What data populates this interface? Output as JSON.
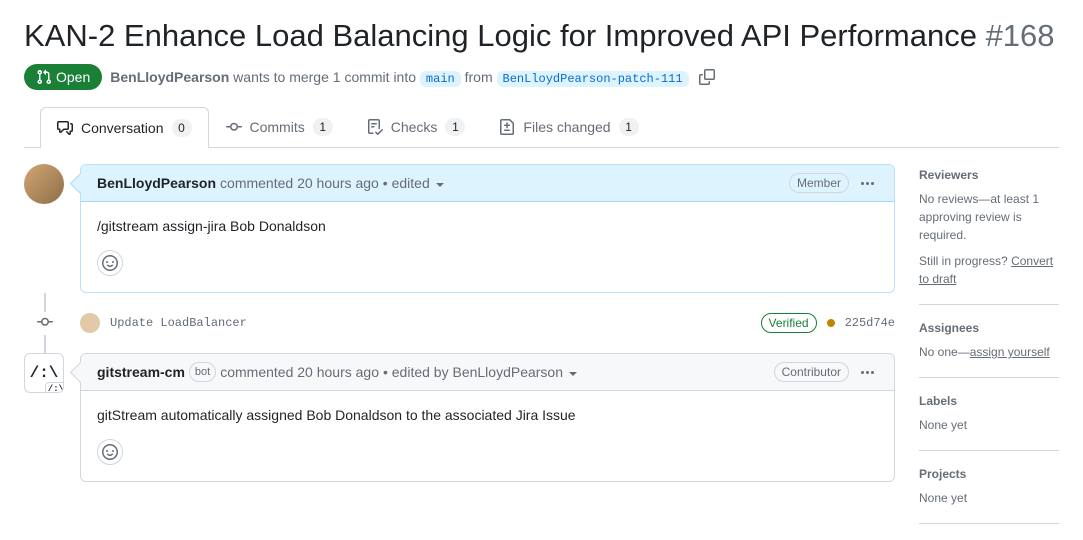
{
  "title": "KAN-2 Enhance Load Balancing Logic for Improved API Performance",
  "issue_number": "#168",
  "status": "Open",
  "author": "BenLloydPearson",
  "merge_text_1": "wants to merge 1 commit into",
  "base_branch": "main",
  "merge_text_2": "from",
  "head_branch": "BenLloydPearson-patch-111",
  "tabs": {
    "conversation": {
      "label": "Conversation",
      "count": "0"
    },
    "commits": {
      "label": "Commits",
      "count": "1"
    },
    "checks": {
      "label": "Checks",
      "count": "1"
    },
    "files": {
      "label": "Files changed",
      "count": "1"
    }
  },
  "comment1": {
    "author": "BenLloydPearson",
    "meta": "commented 20 hours ago",
    "edited": "• edited",
    "role": "Member",
    "body": "/gitstream assign-jira Bob Donaldson"
  },
  "commit": {
    "message": "Update LoadBalancer",
    "verified": "Verified",
    "hash": "225d74e"
  },
  "comment2": {
    "author": "gitstream-cm",
    "bot_label": "bot",
    "meta": "commented 20 hours ago",
    "edited": "• edited by BenLloydPearson",
    "role": "Contributor",
    "body": "gitStream automatically assigned Bob Donaldson to the associated Jira Issue"
  },
  "sidebar": {
    "reviewers": {
      "title": "Reviewers",
      "text": "No reviews—at least 1 approving review is required.",
      "progress": "Still in progress?",
      "convert": "Convert to draft"
    },
    "assignees": {
      "title": "Assignees",
      "text": "No one—",
      "link": "assign yourself"
    },
    "labels": {
      "title": "Labels",
      "text": "None yet"
    },
    "projects": {
      "title": "Projects",
      "text": "None yet"
    }
  }
}
